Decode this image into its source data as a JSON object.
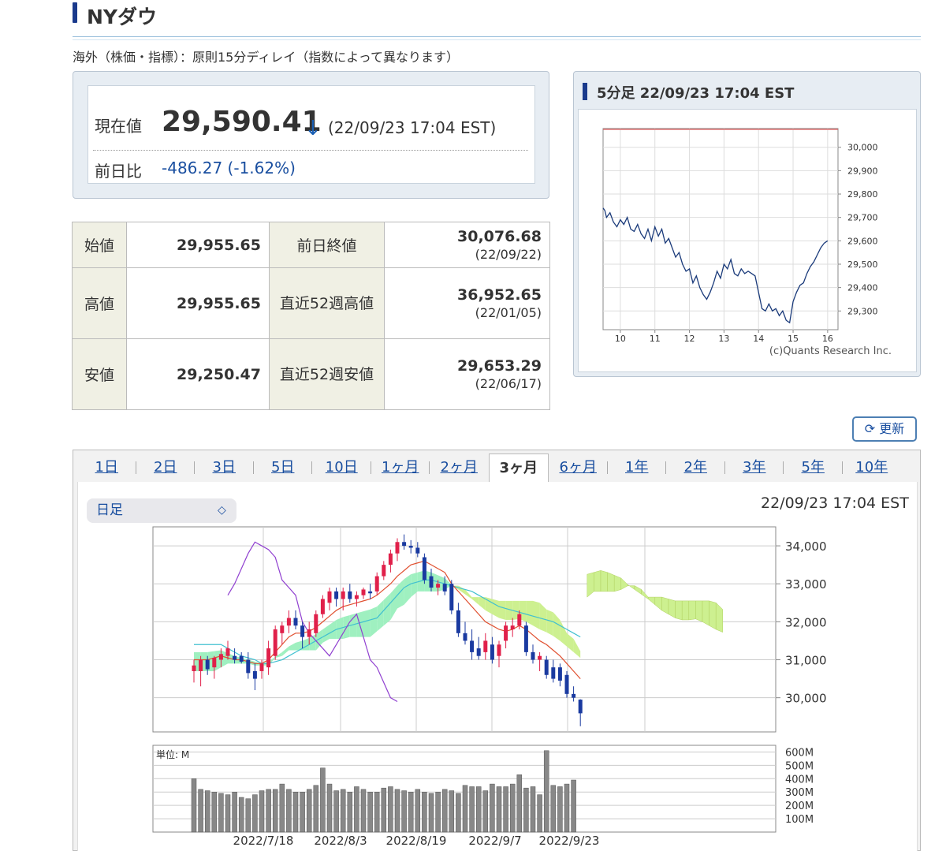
{
  "header": {
    "title": "NYダウ",
    "delay_note": "海外（株価・指標）：原則15分ディレイ（指数によって異なります）"
  },
  "quote": {
    "current_label": "現在値",
    "current_value": "29,590.41",
    "direction_arrow": "↓",
    "current_time": "(22/09/23 17:04 EST)",
    "change_label": "前日比",
    "change_value": "-486.27 (-1.62%)",
    "change_color": "#1a4fa0"
  },
  "stats": {
    "rows": [
      {
        "label": "始値",
        "value": "29,955.65",
        "label2": "前日終値",
        "value2": "30,076.68",
        "date2": "(22/09/22)"
      },
      {
        "label": "高値",
        "value": "29,955.65",
        "label2": "直近52週高値",
        "value2": "36,952.65",
        "date2": "(22/01/05)"
      },
      {
        "label": "安値",
        "value": "29,250.47",
        "label2": "直近52週安値",
        "value2": "29,653.29",
        "date2": "(22/06/17)"
      }
    ]
  },
  "mini_chart": {
    "title": "5分足 22/09/23 17:04 EST",
    "y_ticks": [
      "30,000",
      "29,900",
      "29,800",
      "29,700",
      "29,600",
      "29,500",
      "29,400",
      "29,300"
    ],
    "x_ticks": [
      "10",
      "11",
      "12",
      "13",
      "14",
      "15",
      "16"
    ],
    "credit": "(c)Quants Research Inc."
  },
  "refresh": {
    "label": "更新",
    "icon": "refresh-icon"
  },
  "range_tabs": [
    "1日",
    "2日",
    "3日",
    "5日",
    "10日",
    "1ヶ月",
    "2ヶ月",
    "3ヶ月",
    "6ヶ月",
    "1年",
    "2年",
    "3年",
    "5年",
    "10年"
  ],
  "active_tab": "3ヶ月",
  "candle_panel": {
    "select_value": "日足",
    "timestamp": "22/09/23 17:04 EST",
    "y_ticks": [
      "34,000",
      "33,000",
      "32,000",
      "31,000",
      "30,000"
    ],
    "volume_unit_label": "単位: M",
    "volume_ticks": [
      "600M",
      "500M",
      "400M",
      "300M",
      "200M",
      "100M"
    ],
    "x_ticks": [
      "2022/7/18",
      "2022/8/3",
      "2022/8/19",
      "2022/9/7",
      "2022/9/23"
    ]
  },
  "chart_data": [
    {
      "type": "line",
      "title": "5分足 22/09/23 17:04 EST",
      "xlabel": "",
      "ylabel": "",
      "xlim": [
        9.5,
        16.3
      ],
      "ylim": [
        29220,
        30080
      ],
      "reference_line": 30076.68,
      "colors": {
        "line": "#1a3a7a",
        "reference": "#e06060"
      },
      "series": [
        {
          "x": [
            9.5,
            9.55,
            9.6,
            9.7,
            9.8,
            9.9,
            10.0,
            10.1,
            10.2,
            10.3,
            10.4,
            10.5,
            10.6,
            10.7,
            10.8,
            10.9,
            11.0,
            11.1,
            11.2,
            11.3,
            11.4,
            11.5,
            11.6,
            11.7,
            11.8,
            11.9,
            12.0,
            12.1,
            12.2,
            12.3,
            12.4,
            12.5,
            12.6,
            12.7,
            12.8,
            12.9,
            13.0,
            13.1,
            13.2,
            13.3,
            13.4,
            13.5,
            13.6,
            13.7,
            13.8,
            13.9,
            14.0,
            14.1,
            14.2,
            14.3,
            14.4,
            14.5,
            14.6,
            14.7,
            14.8,
            14.9,
            15.0,
            15.1,
            15.2,
            15.3,
            15.4,
            15.5,
            15.6,
            15.7,
            15.8,
            15.9,
            16.0
          ],
          "y": [
            29740,
            29730,
            29700,
            29720,
            29680,
            29660,
            29690,
            29670,
            29700,
            29650,
            29640,
            29670,
            29630,
            29610,
            29650,
            29600,
            29660,
            29620,
            29650,
            29590,
            29610,
            29570,
            29530,
            29550,
            29500,
            29470,
            29480,
            29420,
            29450,
            29400,
            29370,
            29350,
            29380,
            29420,
            29470,
            29440,
            29500,
            29480,
            29520,
            29460,
            29450,
            29480,
            29460,
            29470,
            29460,
            29450,
            29380,
            29310,
            29300,
            29330,
            29300,
            29310,
            29280,
            29300,
            29260,
            29250,
            29340,
            29380,
            29410,
            29420,
            29460,
            29490,
            29510,
            29540,
            29570,
            29590,
            29600
          ]
        }
      ]
    },
    {
      "type": "candlestick",
      "title": "",
      "xlabel": "",
      "ylabel": "",
      "ylim": [
        29100,
        34500
      ],
      "colors": {
        "up": "#e0204a",
        "down": "#1a3aa0",
        "tenkan": "#e05030",
        "kijun": "#40c0d0",
        "chikou": "#9040d0",
        "cloud_bull": "#9ff0c0",
        "cloud_bear": "#cdf090"
      },
      "candles": [
        {
          "o": 30700,
          "h": 31000,
          "l": 30400,
          "c": 30850
        },
        {
          "o": 30700,
          "h": 31100,
          "l": 30300,
          "c": 31000
        },
        {
          "o": 31000,
          "h": 31100,
          "l": 30600,
          "c": 30750
        },
        {
          "o": 30800,
          "h": 31100,
          "l": 30500,
          "c": 31050
        },
        {
          "o": 31000,
          "h": 31300,
          "l": 30800,
          "c": 31150
        },
        {
          "o": 31100,
          "h": 31500,
          "l": 31000,
          "c": 31300
        },
        {
          "o": 31100,
          "h": 31300,
          "l": 30900,
          "c": 31000
        },
        {
          "o": 31100,
          "h": 31200,
          "l": 30900,
          "c": 30950
        },
        {
          "o": 31000,
          "h": 31200,
          "l": 30500,
          "c": 30650
        },
        {
          "o": 30700,
          "h": 30900,
          "l": 30200,
          "c": 30500
        },
        {
          "o": 30700,
          "h": 31000,
          "l": 30500,
          "c": 30900
        },
        {
          "o": 30800,
          "h": 31500,
          "l": 30600,
          "c": 31300
        },
        {
          "o": 31100,
          "h": 31900,
          "l": 31000,
          "c": 31800
        },
        {
          "o": 31700,
          "h": 32000,
          "l": 31400,
          "c": 31900
        },
        {
          "o": 31900,
          "h": 32300,
          "l": 31700,
          "c": 32100
        },
        {
          "o": 32100,
          "h": 32300,
          "l": 31800,
          "c": 31900
        },
        {
          "o": 31900,
          "h": 32000,
          "l": 31300,
          "c": 31600
        },
        {
          "o": 31600,
          "h": 32000,
          "l": 31400,
          "c": 31800
        },
        {
          "o": 31700,
          "h": 32300,
          "l": 31600,
          "c": 32200
        },
        {
          "o": 32200,
          "h": 32700,
          "l": 32100,
          "c": 32600
        },
        {
          "o": 32500,
          "h": 32900,
          "l": 32300,
          "c": 32800
        },
        {
          "o": 32800,
          "h": 32900,
          "l": 32400,
          "c": 32600
        },
        {
          "o": 32600,
          "h": 32900,
          "l": 32300,
          "c": 32800
        },
        {
          "o": 32800,
          "h": 33000,
          "l": 32500,
          "c": 32600
        },
        {
          "o": 32600,
          "h": 32800,
          "l": 32400,
          "c": 32700
        },
        {
          "o": 32700,
          "h": 32900,
          "l": 32600,
          "c": 32850
        },
        {
          "o": 32800,
          "h": 33000,
          "l": 32600,
          "c": 32750
        },
        {
          "o": 32800,
          "h": 33300,
          "l": 32700,
          "c": 33200
        },
        {
          "o": 33200,
          "h": 33600,
          "l": 33100,
          "c": 33500
        },
        {
          "o": 33500,
          "h": 33900,
          "l": 33300,
          "c": 33800
        },
        {
          "o": 33800,
          "h": 34200,
          "l": 33600,
          "c": 34100
        },
        {
          "o": 34100,
          "h": 34300,
          "l": 33900,
          "c": 34000
        },
        {
          "o": 34000,
          "h": 34150,
          "l": 33800,
          "c": 33950
        },
        {
          "o": 33950,
          "h": 34100,
          "l": 33700,
          "c": 33800
        },
        {
          "o": 33700,
          "h": 33800,
          "l": 33000,
          "c": 33100
        },
        {
          "o": 33200,
          "h": 33400,
          "l": 32800,
          "c": 32900
        },
        {
          "o": 32900,
          "h": 33100,
          "l": 32700,
          "c": 33000
        },
        {
          "o": 33000,
          "h": 33200,
          "l": 32700,
          "c": 32800
        },
        {
          "o": 33000,
          "h": 33100,
          "l": 32200,
          "c": 32300
        },
        {
          "o": 32300,
          "h": 32500,
          "l": 31600,
          "c": 31700
        },
        {
          "o": 31700,
          "h": 32000,
          "l": 31400,
          "c": 31500
        },
        {
          "o": 31500,
          "h": 31800,
          "l": 31000,
          "c": 31200
        },
        {
          "o": 31300,
          "h": 31600,
          "l": 31000,
          "c": 31100
        },
        {
          "o": 31200,
          "h": 31700,
          "l": 31000,
          "c": 31500
        },
        {
          "o": 31400,
          "h": 31600,
          "l": 30900,
          "c": 31000
        },
        {
          "o": 31100,
          "h": 31500,
          "l": 30800,
          "c": 31400
        },
        {
          "o": 31500,
          "h": 32000,
          "l": 31300,
          "c": 31900
        },
        {
          "o": 31800,
          "h": 32100,
          "l": 31600,
          "c": 31900
        },
        {
          "o": 31900,
          "h": 32300,
          "l": 31800,
          "c": 32200
        },
        {
          "o": 31900,
          "h": 32000,
          "l": 31100,
          "c": 31200
        },
        {
          "o": 31200,
          "h": 31400,
          "l": 30900,
          "c": 31000
        },
        {
          "o": 31000,
          "h": 31200,
          "l": 30700,
          "c": 31100
        },
        {
          "o": 31000,
          "h": 31100,
          "l": 30500,
          "c": 30600
        },
        {
          "o": 30800,
          "h": 31000,
          "l": 30400,
          "c": 30500
        },
        {
          "o": 30800,
          "h": 30900,
          "l": 30300,
          "c": 30450
        },
        {
          "o": 30600,
          "h": 30700,
          "l": 30000,
          "c": 30100
        },
        {
          "o": 30100,
          "h": 30300,
          "l": 29900,
          "c": 30000
        },
        {
          "o": 29950,
          "h": 29960,
          "l": 29250,
          "c": 29590
        }
      ],
      "tenkan": [
        31000,
        31000,
        31000,
        31050,
        31100,
        31050,
        31000,
        31000,
        30950,
        30900,
        30900,
        31000,
        31200,
        31400,
        31600,
        31700,
        31700,
        31750,
        31850,
        32000,
        32150,
        32300,
        32400,
        32450,
        32500,
        32550,
        32600,
        32700,
        32850,
        33000,
        33200,
        33350,
        33500,
        33550,
        33600,
        33500,
        33400,
        33300,
        33000,
        32800,
        32600,
        32400,
        32200,
        32000,
        31900,
        31800,
        31750,
        31800,
        31900,
        31800,
        31650,
        31500,
        31400,
        31250,
        31100,
        30900,
        30700,
        30500
      ],
      "kijun": [
        31400,
        31400,
        31400,
        31400,
        31400,
        31300,
        31200,
        31100,
        31050,
        31000,
        30900,
        30900,
        30950,
        31000,
        31100,
        31200,
        31300,
        31400,
        31500,
        31600,
        31700,
        31800,
        31850,
        31900,
        31950,
        32000,
        32050,
        32100,
        32300,
        32500,
        32700,
        32900,
        33000,
        33050,
        33100,
        33100,
        33050,
        33000,
        32950,
        32900,
        32850,
        32800,
        32700,
        32600,
        32500,
        32400,
        32350,
        32300,
        32250,
        32200,
        32150,
        32100,
        32050,
        32000,
        31900,
        31800,
        31700,
        31600
      ],
      "chikou": [
        32700,
        33000,
        33400,
        33800,
        34100,
        34000,
        33900,
        33700,
        33100,
        32900,
        32700,
        32000,
        31700,
        31500,
        31300,
        31100,
        31400,
        31700,
        32000,
        32200,
        31600,
        31000,
        30800,
        30400,
        30000,
        29900
      ]
    },
    {
      "type": "bar",
      "title": "",
      "ylabel": "単位: M",
      "ylim": [
        0,
        650
      ],
      "colors": {
        "bar": "#888888"
      },
      "values": [
        400,
        320,
        310,
        300,
        290,
        280,
        300,
        260,
        250,
        280,
        310,
        320,
        320,
        360,
        320,
        300,
        300,
        320,
        350,
        480,
        360,
        310,
        320,
        300,
        340,
        320,
        300,
        300,
        330,
        340,
        320,
        310,
        300,
        320,
        300,
        290,
        300,
        320,
        310,
        290,
        350,
        340,
        340,
        310,
        360,
        340,
        340,
        360,
        430,
        330,
        340,
        280,
        610,
        350,
        340,
        360,
        390
      ]
    }
  ]
}
